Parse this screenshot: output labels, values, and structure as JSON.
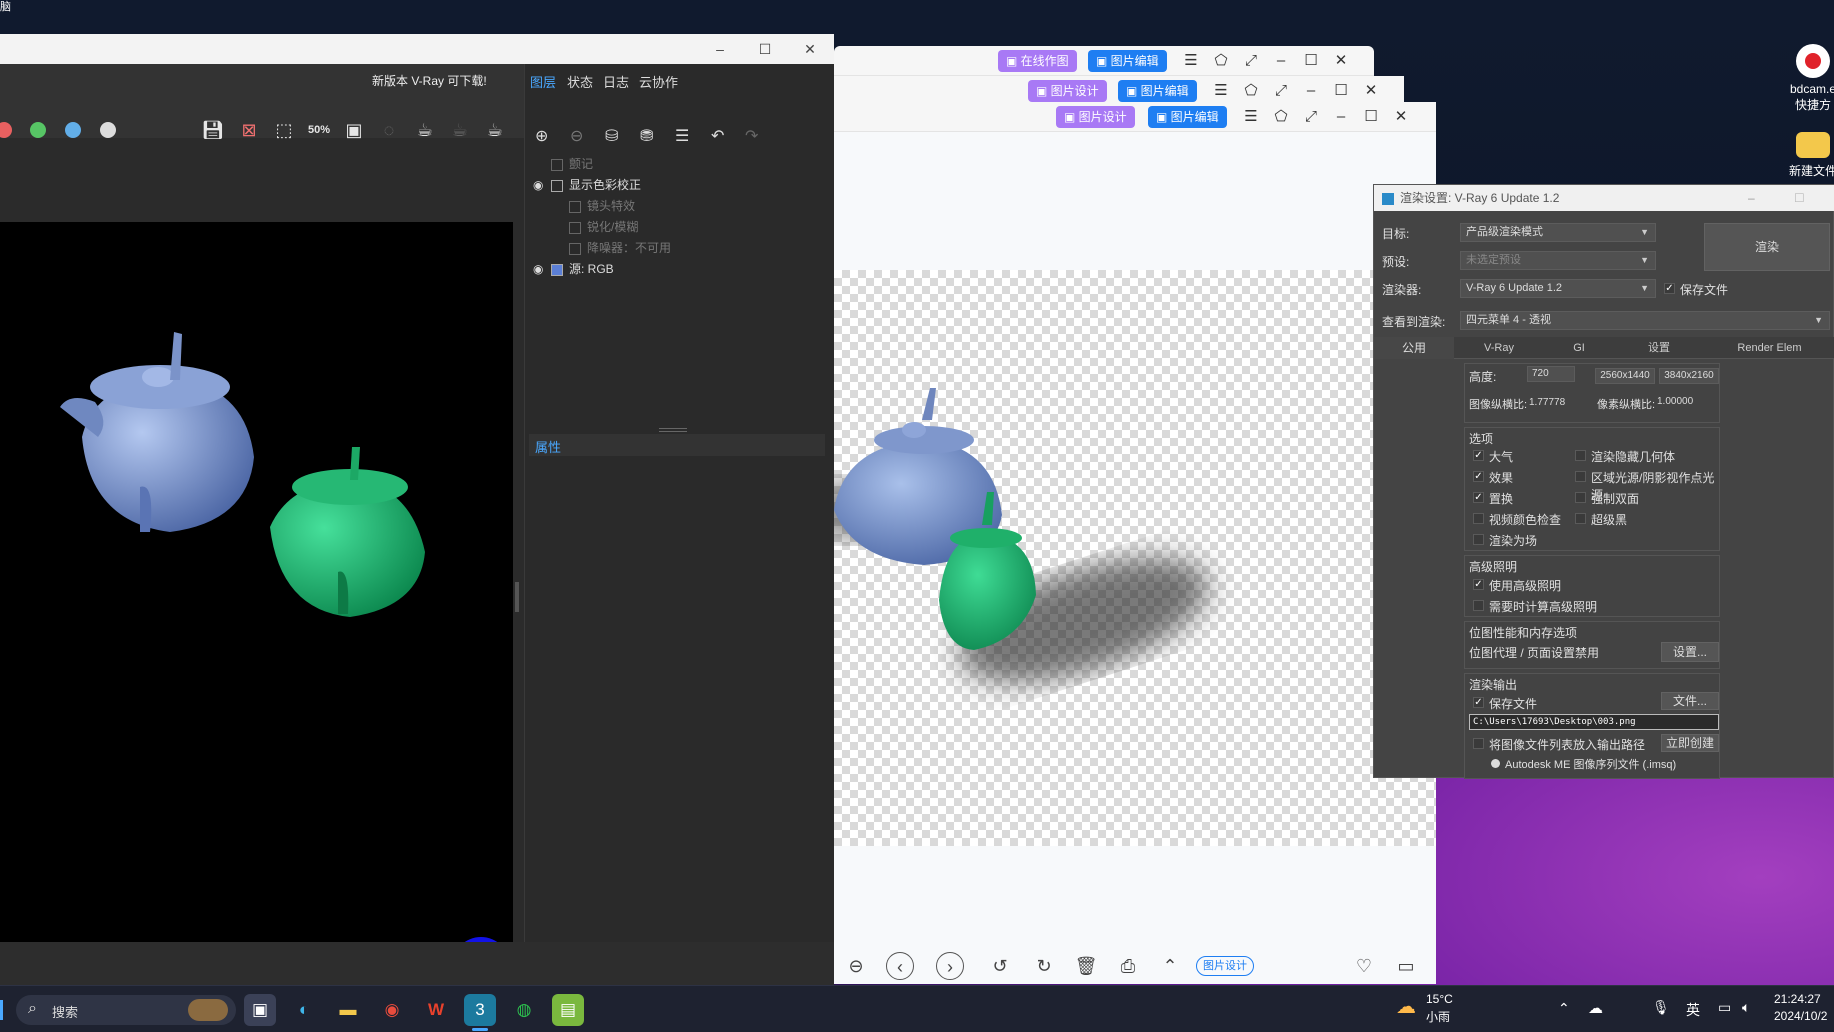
{
  "desktop": {
    "corner_text": "脑",
    "icons": [
      {
        "label": "bdcam.e",
        "sublabel": "快捷方"
      },
      {
        "label": "新建文件"
      }
    ]
  },
  "vfb": {
    "update_notice": "新版本 V-Ray 可下载!",
    "side_tabs": [
      "图层",
      "状态",
      "日志",
      "云协作"
    ],
    "layers": [
      {
        "label": "颤记",
        "dim": true
      },
      {
        "label": "显示色彩校正",
        "dim": false
      },
      {
        "label": "镜头特效",
        "dim": true
      },
      {
        "label": "锐化/模糊",
        "dim": true
      },
      {
        "label": "降噪器：不可用",
        "dim": true
      },
      {
        "label": "源:  RGB",
        "dim": false
      }
    ],
    "properties_label": "属性",
    "toolbar_icons": [
      "save-icon",
      "clear-icon",
      "region-icon",
      "zoom-50-icon",
      "compare-icon",
      "render-icon"
    ],
    "zoom_label": "50%"
  },
  "viewers": {
    "btn_online": "在线作图",
    "btn_design": "图片设计",
    "btn_edit": "图片编辑",
    "bottom_tag": "图片设计"
  },
  "render_settings": {
    "title": "渲染设置: V-Ray 6 Update 1.2",
    "target_label": "目标:",
    "target_value": "产品级渲染模式",
    "preset_label": "预设:",
    "preset_value": "未选定预设",
    "renderer_label": "渲染器:",
    "renderer_value": "V-Ray 6 Update 1.2",
    "save_file_label": "保存文件",
    "render_button": "渲染",
    "view_label": "查看到渲染:",
    "view_value": "四元菜单 4 - 透视",
    "tabs": [
      "公用",
      "V-Ray",
      "GI",
      "设置",
      "Render Elem"
    ],
    "height_label": "高度:",
    "height_value": "720",
    "preset_sizes": [
      "2560x1440",
      "3840x2160"
    ],
    "image_aspect_label": "图像纵横比:",
    "image_aspect_value": "1.77778",
    "pixel_aspect_label": "像素纵横比:",
    "pixel_aspect_value": "1.00000",
    "options_title": "选项",
    "options": [
      {
        "label": "大气",
        "checked": true
      },
      {
        "label": "渲染隐藏几何体",
        "checked": false
      },
      {
        "label": "效果",
        "checked": true
      },
      {
        "label": "区域光源/阴影视作点光源",
        "checked": false
      },
      {
        "label": "置换",
        "checked": true
      },
      {
        "label": "强制双面",
        "checked": false
      },
      {
        "label": "视频颜色检查",
        "checked": false
      },
      {
        "label": "超级黑",
        "checked": false
      },
      {
        "label": "渲染为场",
        "checked": false
      }
    ],
    "advanced_title": "高级照明",
    "advanced": [
      {
        "label": "使用高级照明",
        "checked": true
      },
      {
        "label": "需要时计算高级照明",
        "checked": false
      }
    ],
    "bitmap_title": "位图性能和内存选项",
    "bitmap_text": "位图代理 / 页面设置禁用",
    "bitmap_button": "设置...",
    "output_title": "渲染输出",
    "output_save_label": "保存文件",
    "output_file_button": "文件...",
    "output_path": "C:\\Users\\17693\\Desktop\\003.png",
    "output_list_label": "将图像文件列表放入输出路径",
    "output_create_button": "立即创建",
    "output_imsq_label": "Autodesk ME 图像序列文件 (.imsq)"
  },
  "taskbar": {
    "search_placeholder": "搜索",
    "weather_temp": "15°C",
    "weather_desc": "小雨",
    "ime": "英",
    "time": "21:24:27",
    "date": "2024/10/2"
  }
}
